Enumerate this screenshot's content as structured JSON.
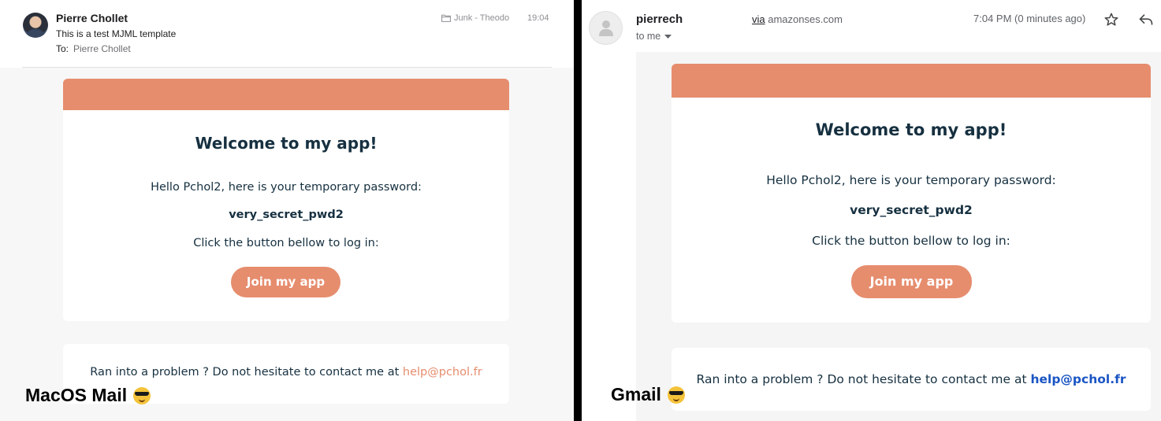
{
  "mac": {
    "sender": "Pierre Chollet",
    "subject": "This is a test MJML template",
    "to_label": "To:",
    "to_name": "Pierre Chollet",
    "folder": "Junk - Theodo",
    "time": "19:04",
    "label": "MacOS Mail"
  },
  "gmail": {
    "sender": "pierrech",
    "to_me": "to me",
    "via_word": "via",
    "via_domain": "amazonses.com",
    "time": "7:04 PM (0 minutes ago)",
    "label": "Gmail"
  },
  "email": {
    "title": "Welcome to my app!",
    "greeting": "Hello Pchol2, here is your temporary password:",
    "password": "very_secret_pwd2",
    "instruction": "Click the button bellow to log in:",
    "cta_label": "Join my app",
    "footer_text": "Ran into a problem ? Do not hesitate to contact me at ",
    "footer_email": "help@pchol.fr"
  },
  "colors": {
    "accent": "#e68d6e",
    "text": "#163040",
    "gmail_link": "#1a55c4"
  },
  "icons": {
    "label_emoji": "smiling-face-with-sunglasses",
    "mac_folder": "folder-icon",
    "gmail_star": "star-icon",
    "gmail_reply": "reply-icon"
  }
}
